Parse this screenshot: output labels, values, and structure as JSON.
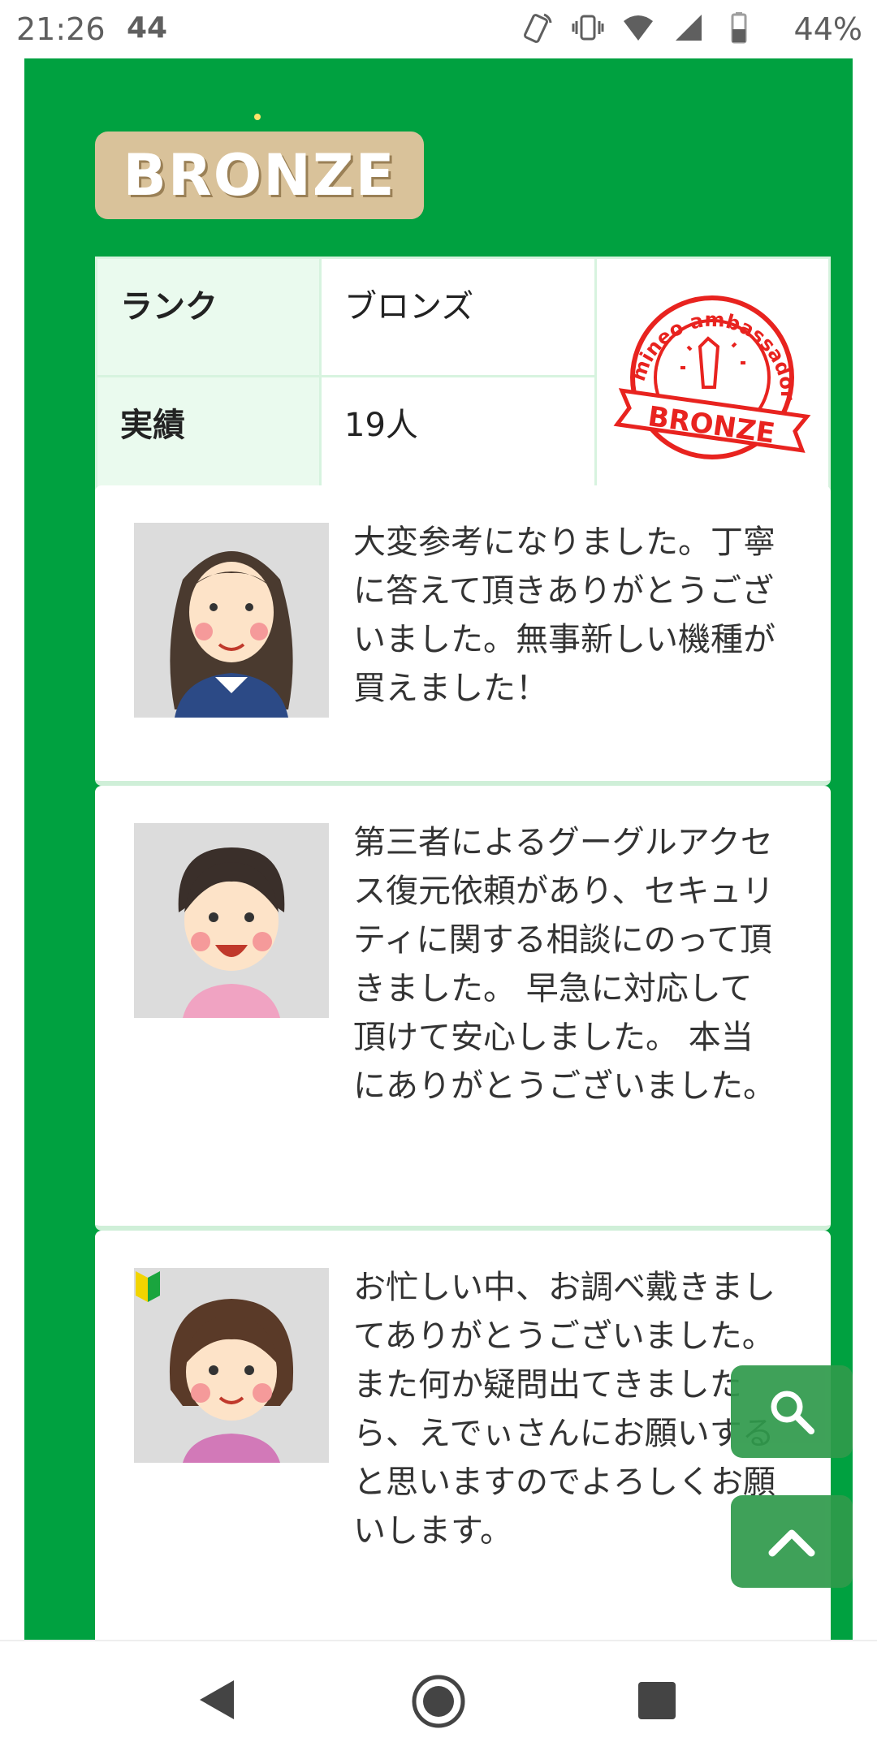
{
  "status_bar": {
    "time": "21:26",
    "notif_count": "44",
    "battery_percent": "44%",
    "icons": [
      "nfc-icon",
      "vibrate-icon",
      "wifi-icon",
      "signal-icon",
      "battery-icon"
    ]
  },
  "badge": {
    "label": "BRONZE"
  },
  "rank_table": {
    "row1_header": "ランク",
    "row1_value": "ブロンズ",
    "row2_header": "実績",
    "row2_value": "19人",
    "stamp": {
      "arc_text": "mineo ambassador",
      "banner_text": "BRONZE",
      "color": "#e8231f"
    }
  },
  "reviews": [
    {
      "text": "大変参考になりました。丁寧に答えて頂きありがとうございました。無事新しい機種が買えました！"
    },
    {
      "text": "第三者によるグーグルアクセス復元依頼があり、セキュリティに関する相談にのって頂きました。 早急に対応して頂けて安心しました。 本当にありがとうございました。"
    },
    {
      "text": "お忙しい中、お調べ戴きましてありがとうございました。 また何か疑問出てきましたら、えでぃさんにお願いすると思いますのでよろしくお願いします。"
    }
  ],
  "floating_buttons": {
    "search": "search-icon",
    "top": "chevron-up-icon"
  },
  "colors": {
    "panel_green": "#00a140",
    "bronze": "#d9c29a",
    "stamp_red": "#e8231f",
    "fab_green": "#2f9a4b"
  }
}
